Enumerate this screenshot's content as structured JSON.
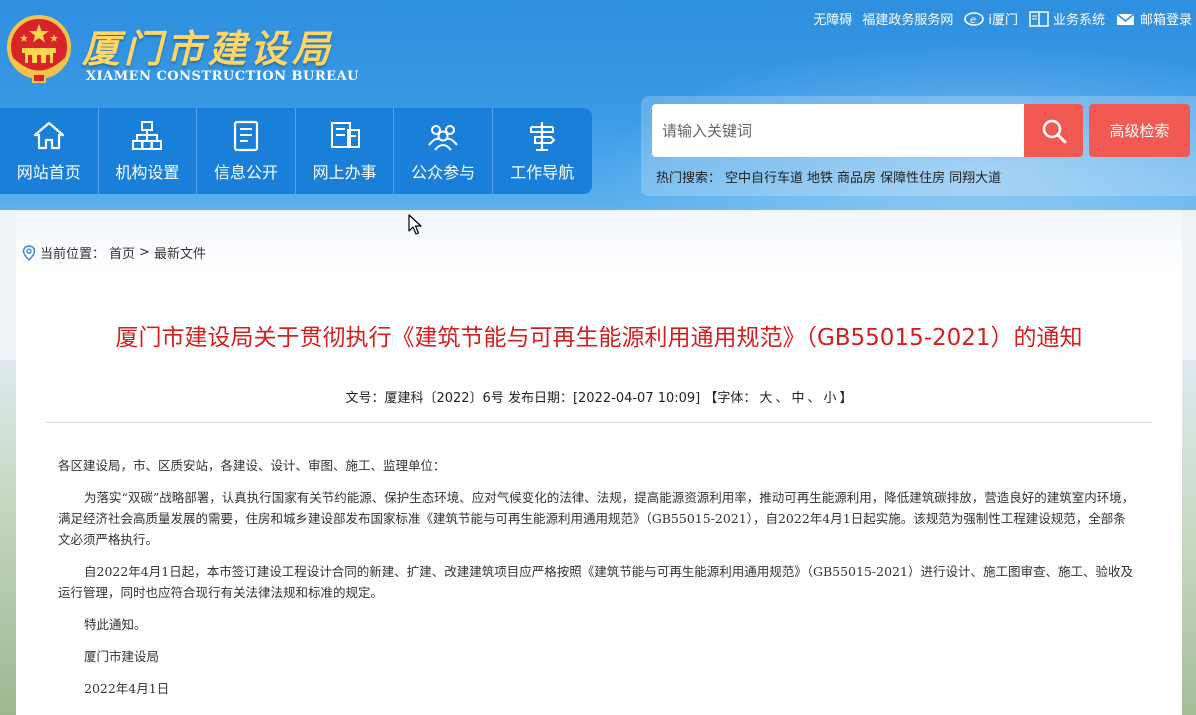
{
  "header": {
    "logo_cn": "厦门市建设局",
    "logo_en": "XIAMEN CONSTRUCTION BUREAU",
    "toplinks": {
      "accessibility": "无障碍",
      "fujian_gov": "福建政务服务网",
      "ixiamen": "i厦门",
      "business": "业务系统",
      "mail": "邮箱登录"
    }
  },
  "nav": {
    "home": "网站首页",
    "org": "机构设置",
    "info": "信息公开",
    "online": "网上办事",
    "public": "公众参与",
    "guide": "工作导航"
  },
  "search": {
    "placeholder": "请输入关键词",
    "advanced": "高级检索",
    "hot_label": "热门搜索：",
    "hot_items": [
      "空中自行车道",
      "地铁",
      "商品房",
      "保障性住房",
      "同翔大道"
    ]
  },
  "breadcrumb": {
    "label": "当前位置：",
    "home": "首页",
    "sep": ">",
    "current": "最新文件"
  },
  "article": {
    "title": "厦门市建设局关于贯彻执行《建筑节能与可再生能源利用通用规范》（GB55015-2021）的通知",
    "meta_doc": "文号：厦建科〔2022〕6号",
    "meta_date": "发布日期：[2022-04-07 10:09]",
    "font_label": "【字体：",
    "font_large": "大",
    "font_mid": "中",
    "font_small": "小",
    "font_end": "】",
    "p1": "各区建设局，市、区质安站，各建设、设计、审图、施工、监理单位：",
    "p2": "为落实“双碳”战略部署，认真执行国家有关节约能源、保护生态环境、应对气候变化的法律、法规，提高能源资源利用率，推动可再生能源利用，降低建筑碳排放，营造良好的建筑室内环境，满足经济社会高质量发展的需要，住房和城乡建设部发布国家标准《建筑节能与可再生能源利用通用规范》（GB55015-2021），自2022年4月1日起实施。该规范为强制性工程建设规范，全部条文必须严格执行。",
    "p3": "自2022年4月1日起，本市签订建设工程设计合同的新建、扩建、改建建筑项目应严格按照《建筑节能与可再生能源利用通用规范》（GB55015-2021）进行设计、施工图审查、施工、验收及运行管理，同时也应符合现行有关法律法规和标准的规定。",
    "p4": "特此通知。",
    "sign": "厦门市建设局",
    "date": "2022年4月1日"
  },
  "colors": {
    "title_red": "#d21f1f",
    "nav_blue": "#1a7fd8",
    "header_blue": "#2e8fdf",
    "search_red": "#f05a52",
    "logo_gold": "#ffd566"
  }
}
